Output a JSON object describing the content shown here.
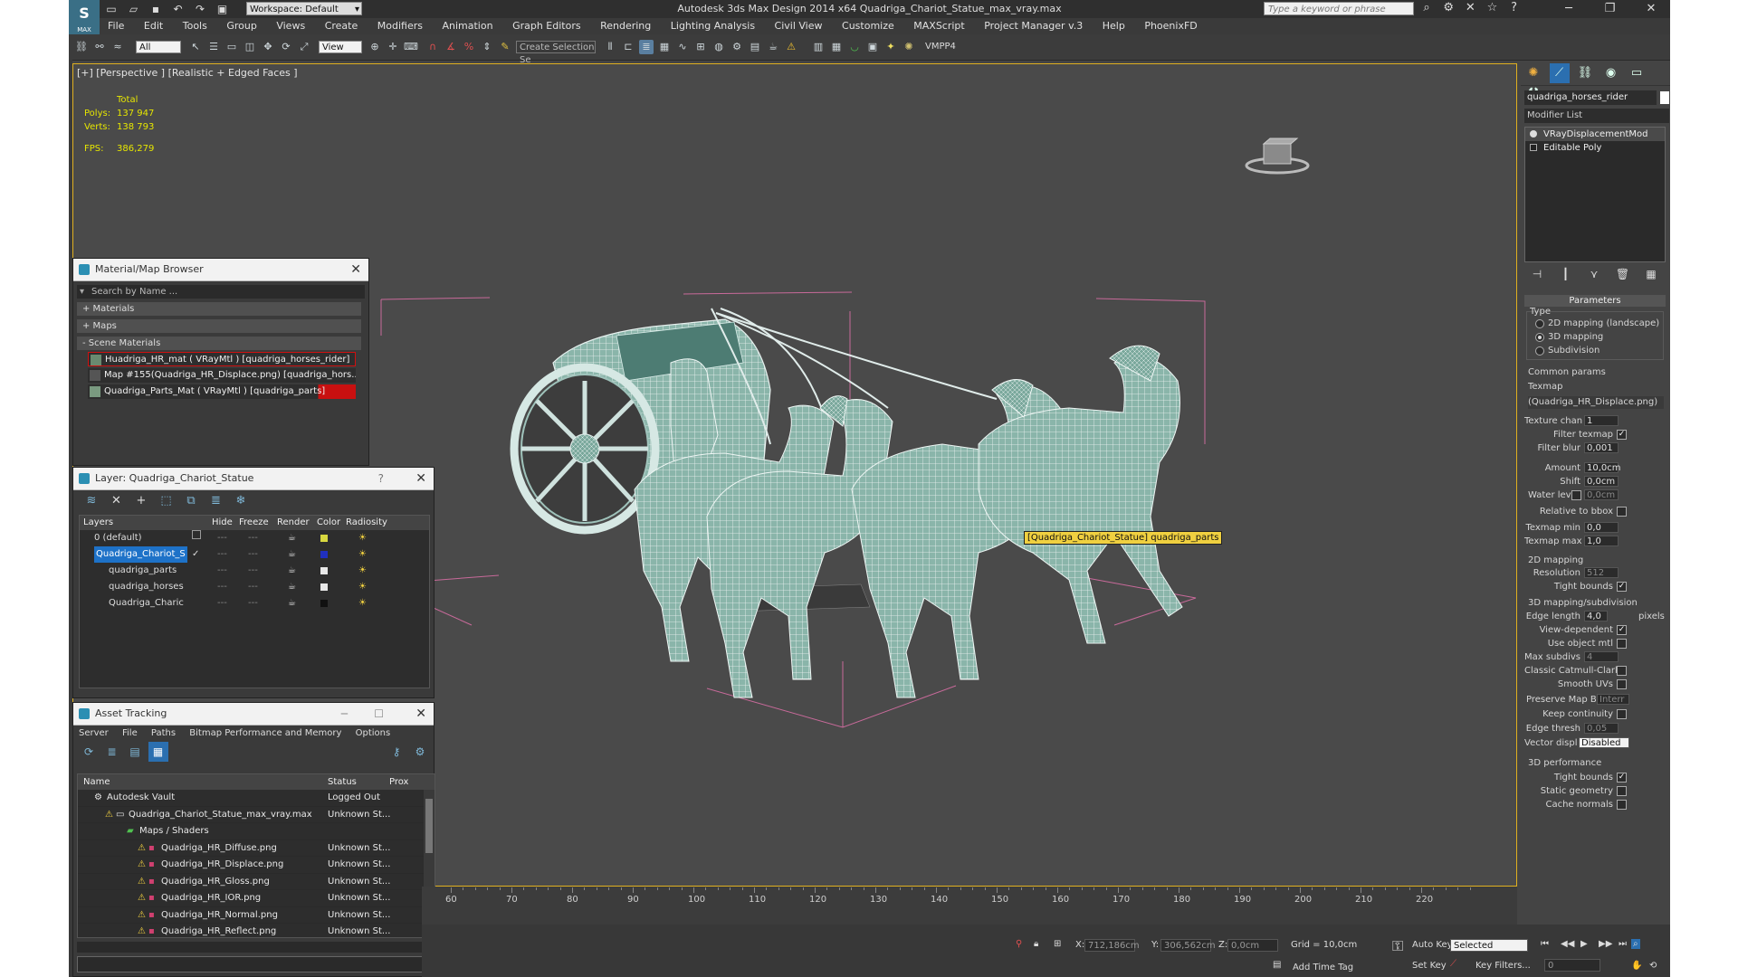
{
  "app": {
    "title": "Autodesk 3ds Max Design 2014 x64     Quadriga_Chariot_Statue_max_vray.max",
    "logo": "MAX",
    "workspace": "Workspace: Default",
    "search_placeholder": "Type a keyword or phrase"
  },
  "menu": [
    "File",
    "Edit",
    "Tools",
    "Group",
    "Views",
    "Create",
    "Modifiers",
    "Animation",
    "Graph Editors",
    "Rendering",
    "Lighting Analysis",
    "Civil View",
    "Customize",
    "MAXScript",
    "Project Manager v.3",
    "Help",
    "PhoenixFD"
  ],
  "toolbar": {
    "filter_select": "All",
    "view_select": "View",
    "selection_set": "Create Selection Se",
    "vmpp": "VMPP4"
  },
  "viewport": {
    "label": "[+] [Perspective ] [Realistic + Edged Faces ]",
    "stats_header": "Total",
    "polys_label": "Polys:",
    "polys": "137 947",
    "verts_label": "Verts:",
    "verts": "138 793",
    "fps_label": "FPS:",
    "fps": "386,279",
    "tooltip": "[Quadriga_Chariot_Statue] quadriga_parts"
  },
  "material_browser": {
    "title": "Material/Map Browser",
    "search": "Search by Name ...",
    "rollouts": [
      "+ Materials",
      "+ Maps",
      "- Scene Materials"
    ],
    "items": [
      "Huadriga_HR_mat  ( VRayMtl ) [quadriga_horses_rider]",
      "Map #155(Quadriga_HR_Displace.png) [quadriga_hors...",
      "Quadriga_Parts_Mat  ( VRayMtl ) [quadriga_parts]"
    ]
  },
  "layer_manager": {
    "title": "Layer: Quadriga_Chariot_Statue",
    "help": "?",
    "columns": [
      "Layers",
      "Hide",
      "Freeze",
      "Render",
      "Color",
      "Radiosity"
    ],
    "rows": [
      {
        "name": "0 (default)",
        "color": "#d8d840"
      },
      {
        "name": "Quadriga_Chariot_S",
        "color": "#2030c0"
      },
      {
        "name": "quadriga_parts",
        "color": "#e8e8e8"
      },
      {
        "name": "quadriga_horses",
        "color": "#e8e8e8"
      },
      {
        "name": "Quadriga_Charic",
        "color": "#111111"
      }
    ]
  },
  "asset_tracking": {
    "title": "Asset Tracking",
    "menu": [
      "Server",
      "File",
      "Paths",
      "Bitmap Performance and Memory",
      "Options"
    ],
    "columns": [
      "Name",
      "Status",
      "Prox"
    ],
    "rows": [
      {
        "name": "Autodesk Vault",
        "status": "Logged Out"
      },
      {
        "name": "Quadriga_Chariot_Statue_max_vray.max",
        "status": "Unknown St..."
      },
      {
        "name": "Maps / Shaders",
        "status": ""
      },
      {
        "name": "Quadriga_HR_Diffuse.png",
        "status": "Unknown St..."
      },
      {
        "name": "Quadriga_HR_Displace.png",
        "status": "Unknown St..."
      },
      {
        "name": "Quadriga_HR_Gloss.png",
        "status": "Unknown St..."
      },
      {
        "name": "Quadriga_HR_IOR.png",
        "status": "Unknown St..."
      },
      {
        "name": "Quadriga_HR_Normal.png",
        "status": "Unknown St..."
      },
      {
        "name": "Quadriga_HR_Reflect.png",
        "status": "Unknown St..."
      }
    ]
  },
  "timeline": {
    "ticks": [
      "60",
      "70",
      "80",
      "90",
      "100",
      "110",
      "120",
      "130",
      "140",
      "150",
      "160",
      "170",
      "180",
      "190",
      "200",
      "210",
      "220"
    ]
  },
  "status": {
    "x_label": "X:",
    "x": "712,186cm",
    "y_label": "Y:",
    "y": "306,562cm",
    "z_label": "Z:",
    "z": "0,0cm",
    "grid": "Grid = 10,0cm",
    "add_time_tag": "Add Time Tag",
    "auto_key": "Auto Key",
    "selected": "Selected",
    "set_key": "Set Key",
    "key_filters": "Key Filters...",
    "frame": "0"
  },
  "command_panel": {
    "object_name": "quadriga_horses_rider",
    "modifier_list": "Modifier List",
    "stack": [
      "VRayDisplacementMod",
      "Editable Poly"
    ],
    "parameters_title": "Parameters",
    "type_label": "Type",
    "type_options": [
      "2D mapping (landscape)",
      "3D mapping",
      "Subdivision"
    ],
    "common_params": "Common params",
    "texmap_label": "Texmap",
    "texmap_value": "(Quadriga_HR_Displace.png)",
    "texture_chan_label": "Texture chan",
    "texture_chan": "1",
    "filter_texmap": "Filter texmap",
    "filter_blur_label": "Filter blur",
    "filter_blur": "0,001",
    "amount_label": "Amount",
    "amount": "10,0cm",
    "shift_label": "Shift",
    "shift": "0,0cm",
    "water_level_label": "Water level",
    "water_level": "0,0cm",
    "relative_to_bbox": "Relative to bbox",
    "texmap_min_label": "Texmap min",
    "texmap_min": "0,0",
    "texmap_max_label": "Texmap max",
    "texmap_max": "1,0",
    "mapping2d_title": "2D mapping",
    "resolution_label": "Resolution",
    "resolution": "512",
    "tight_bounds": "Tight bounds",
    "mapping3d_title": "3D mapping/subdivision",
    "edge_length_label": "Edge length",
    "edge_length": "4,0",
    "pixels": "pixels",
    "view_dependent": "View-dependent",
    "use_object_mtl": "Use object mtl",
    "max_subdivs_label": "Max subdivs",
    "max_subdivs": "4",
    "classic_catmull": "Classic Catmull-Clark",
    "smooth_uvs": "Smooth UVs",
    "preserve_map_bnd_label": "Preserve Map Bnd",
    "preserve_map_bnd": "Interr",
    "keep_continuity": "Keep continuity",
    "edge_thresh_label": "Edge thresh",
    "edge_thresh": "0,05",
    "vector_disp_label": "Vector displ",
    "vector_disp": "Disabled",
    "perf_title": "3D performance",
    "perf_tight_bounds": "Tight bounds",
    "static_geometry": "Static geometry",
    "cache_normals": "Cache normals"
  }
}
